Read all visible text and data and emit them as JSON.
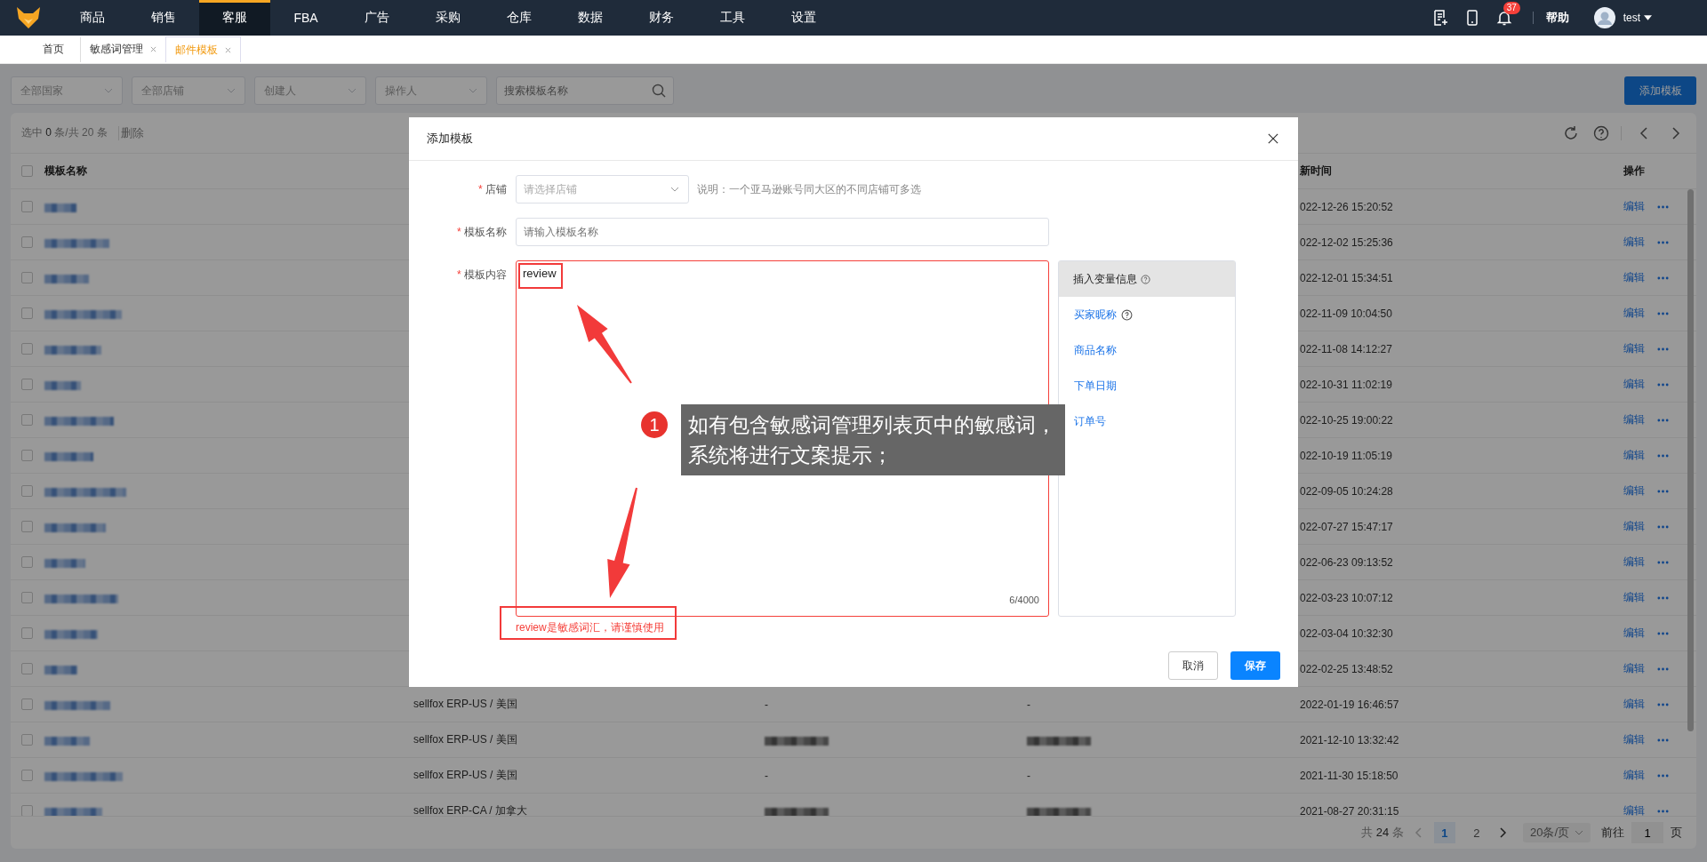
{
  "nav": {
    "items": [
      {
        "label": "商品",
        "selected": false
      },
      {
        "label": "销售",
        "selected": false
      },
      {
        "label": "客服",
        "selected": true
      },
      {
        "label": "FBA",
        "selected": false
      },
      {
        "label": "广告",
        "selected": false
      },
      {
        "label": "采购",
        "selected": false
      },
      {
        "label": "仓库",
        "selected": false
      },
      {
        "label": "数据",
        "selected": false
      },
      {
        "label": "财务",
        "selected": false
      },
      {
        "label": "工具",
        "selected": false
      },
      {
        "label": "设置",
        "selected": false
      }
    ],
    "notification_count": "37",
    "help": "帮助",
    "user": "test"
  },
  "tabs": [
    {
      "label": "首页",
      "closable": false,
      "selected": false
    },
    {
      "label": "敏感词管理",
      "closable": true,
      "selected": false
    },
    {
      "label": "邮件模板",
      "closable": true,
      "selected": true
    }
  ],
  "filters": [
    {
      "kind": "select",
      "placeholder": "全部国家"
    },
    {
      "kind": "select",
      "placeholder": "全部店铺"
    },
    {
      "kind": "select",
      "placeholder": "创建人"
    },
    {
      "kind": "select",
      "placeholder": "操作人"
    },
    {
      "kind": "search",
      "placeholder": "搜索模板名称"
    }
  ],
  "add_button": "添加模板",
  "toolbar": {
    "summary": "选中 **0** 条/共 20 条",
    "delete": "删除"
  },
  "table": {
    "header_checked": false,
    "columns": {
      "name": "模板名称",
      "time": "新时间",
      "actions": "操作"
    },
    "rows": [
      {
        "checked": false,
        "time": "022-12-26 15:20:52",
        "edit": "编辑"
      },
      {
        "checked": false,
        "time": "022-12-02 15:25:36",
        "edit": "编辑"
      },
      {
        "checked": false,
        "time": "022-12-01 15:34:51",
        "edit": "编辑"
      },
      {
        "checked": false,
        "time": "022-11-09 10:04:50",
        "edit": "编辑"
      },
      {
        "checked": false,
        "time": "022-11-08 14:12:27",
        "edit": "编辑"
      },
      {
        "checked": false,
        "time": "022-10-31 11:02:19",
        "edit": "编辑"
      },
      {
        "checked": false,
        "time": "022-10-25 19:00:22",
        "edit": "编辑"
      },
      {
        "checked": false,
        "time": "022-10-19 11:05:19",
        "edit": "编辑"
      },
      {
        "checked": false,
        "time": "022-09-05 10:24:28",
        "edit": "编辑"
      },
      {
        "checked": false,
        "time": "022-07-27 15:47:17",
        "edit": "编辑"
      },
      {
        "checked": false,
        "time": "022-06-23 09:13:52",
        "edit": "编辑"
      },
      {
        "checked": false,
        "time": "022-03-23 10:07:12",
        "edit": "编辑"
      },
      {
        "checked": false,
        "time": "022-03-04 10:32:30",
        "edit": "编辑"
      },
      {
        "checked": false,
        "time": "022-02-25 13:48:52",
        "edit": "编辑"
      },
      {
        "checked": false,
        "shop": "sellfox ERP-US / 美国",
        "column_3": {
          "kind": "text",
          "text": "-"
        },
        "column_4": {
          "kind": "text",
          "text": "-"
        },
        "time": "2022-01-19 16:46:57",
        "edit": "编辑"
      },
      {
        "checked": false,
        "shop": "sellfox ERP-US / 美国",
        "column_3": {
          "kind": "redacted"
        },
        "column_4": {
          "kind": "redacted"
        },
        "time": "2021-12-10 13:32:42",
        "edit": "编辑"
      },
      {
        "checked": false,
        "shop": "sellfox ERP-US / 美国",
        "column_3": {
          "kind": "text",
          "text": "-"
        },
        "column_4": {
          "kind": "text",
          "text": "-"
        },
        "time": "2021-11-30 15:18:50",
        "edit": "编辑"
      },
      {
        "checked": false,
        "shop": "sellfox ERP-CA / 加拿大",
        "column_3": {
          "kind": "redacted"
        },
        "column_4": {
          "kind": "redacted"
        },
        "time": "2021-08-27 20:31:15",
        "edit": "编辑"
      }
    ]
  },
  "pagination": {
    "total": "共 **24** 条",
    "pages": [
      {
        "label": "1",
        "selected": true
      },
      {
        "label": "2",
        "selected": false
      }
    ],
    "page_size": "20条/页",
    "goto_label": "前往",
    "goto_value": "1",
    "page_unit": "页"
  },
  "modal": {
    "title": "添加模板",
    "store": {
      "label": "店铺",
      "required_mark": "*",
      "placeholder": "请选择店铺",
      "note": "说明：一个亚马逊账号同大区的不同店铺可多选"
    },
    "name": {
      "label": "模板名称",
      "required_mark": "*",
      "placeholder": "请输入模板名称"
    },
    "content": {
      "label": "模板内容",
      "required_mark": "*",
      "value": "review",
      "counter": "6/4000",
      "error": "review是敏感词汇，请谨慎使用"
    },
    "variables": {
      "title": "插入变量信息",
      "items": [
        {
          "label": "买家昵称",
          "help": true
        },
        {
          "label": "商品名称",
          "help": false
        },
        {
          "label": "下单日期",
          "help": false
        },
        {
          "label": "订单号",
          "help": false
        }
      ]
    },
    "cancel": "取消",
    "save": "保存"
  },
  "annotation": {
    "number": "1",
    "text": "如有包含敏感词管理列表页中的敏感词，系统将进行文案提示；"
  }
}
